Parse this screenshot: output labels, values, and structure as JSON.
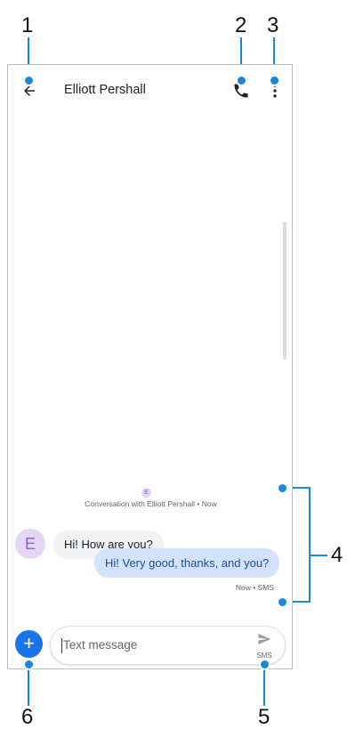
{
  "callouts": [
    "1",
    "2",
    "3",
    "4",
    "5",
    "6"
  ],
  "header": {
    "title": "Elliott Pershall"
  },
  "conversation": {
    "avatar_initial_small": "E",
    "info": "Conversation with Elliott Pershall • Now"
  },
  "messages": {
    "incoming": {
      "avatar_initial": "E",
      "text": "Hi! How are you?"
    },
    "outgoing": {
      "text": "Hi! Very good, thanks, and you?",
      "meta": "Now • SMS"
    }
  },
  "composer": {
    "placeholder": "Text message",
    "send_label": "SMS",
    "add_symbol": "+"
  },
  "colors": {
    "accent": "#1a87d6",
    "fab": "#1a73e8",
    "outgoing_bubble": "#d3e3fd",
    "incoming_bubble": "#f1f3f4",
    "avatar": "#e4d6f6"
  },
  "icons": [
    "back-arrow-icon",
    "phone-icon",
    "more-vert-icon",
    "send-icon",
    "plus-icon"
  ]
}
